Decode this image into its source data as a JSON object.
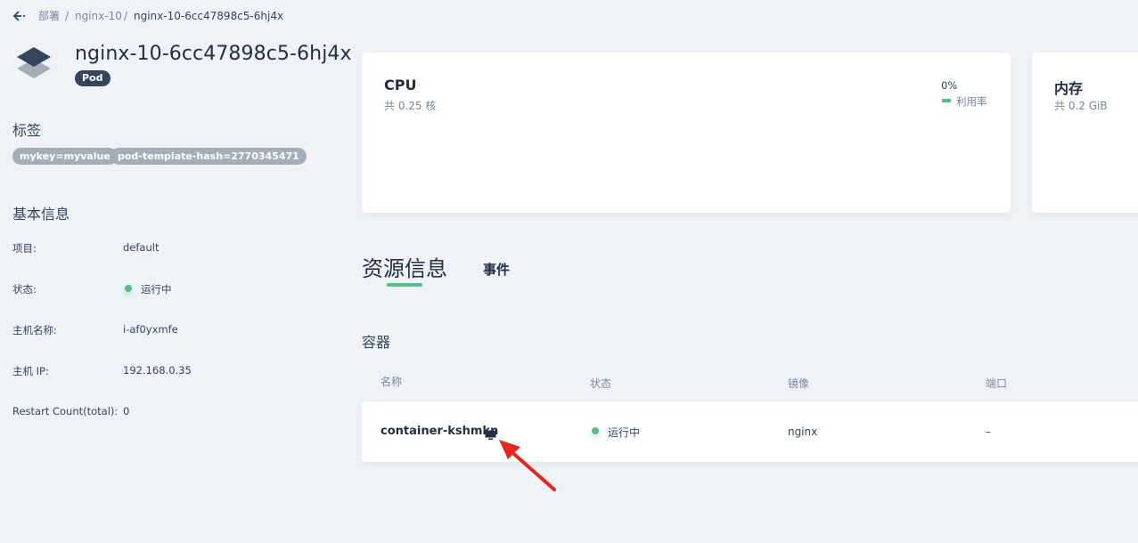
{
  "breadcrumb": {
    "items": [
      "部署",
      "nginx-10",
      "nginx-10-6cc47898c5-6hj4x"
    ],
    "separator": "/"
  },
  "header": {
    "pod_name": "nginx-10-6cc47898c5-6hj4x",
    "kind": "Pod"
  },
  "labels": {
    "title": "标签",
    "items": [
      "mykey=myvalue",
      "pod-template-hash=2770345471"
    ]
  },
  "basic_info": {
    "title": "基本信息",
    "rows": [
      {
        "key": "项目:",
        "value": "default"
      },
      {
        "key": "状态:",
        "value": "运行中"
      },
      {
        "key": "主机名称:",
        "value": "i-af0yxmfe"
      },
      {
        "key": "主机 IP:",
        "value": "192.168.0.35"
      },
      {
        "key": "Restart Count(total):",
        "value": "0"
      }
    ]
  },
  "cpu_card": {
    "title": "CPU",
    "subtitle": "共 0.25 核",
    "value": "0%",
    "legend": "利用率"
  },
  "memory_card": {
    "title": "内存",
    "subtitle": "共 0.2 GiB"
  },
  "tabs": [
    {
      "label": "资源信息",
      "active": true
    },
    {
      "label": "事件",
      "active": false
    }
  ],
  "containers": {
    "title": "容器",
    "columns": [
      "名称",
      "状态",
      "镜像",
      "端口"
    ],
    "rows": [
      {
        "name": "container-kshmkn",
        "status": "运行中",
        "image": "nginx",
        "ports": "–"
      }
    ]
  },
  "colors": {
    "accent_green": "#55bc8a",
    "text_dark": "#242e42",
    "background": "#eff3f8",
    "annotation_arrow": "#e5281c"
  },
  "icons": [
    "back-arrow-icon",
    "pod-layers-icon",
    "terminal-icon",
    "status-running-dot"
  ]
}
